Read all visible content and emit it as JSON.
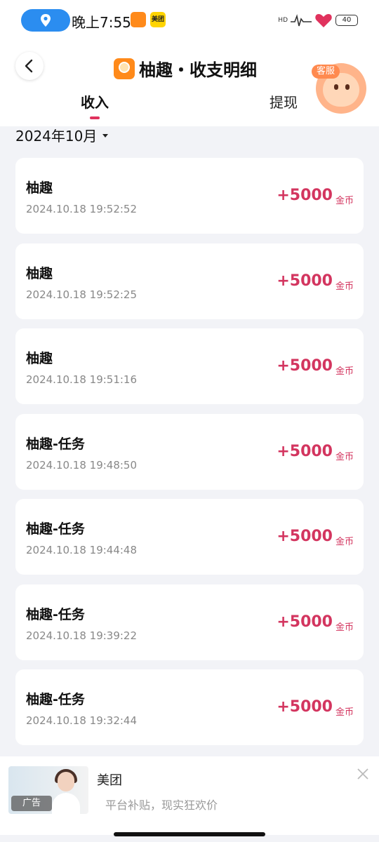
{
  "status_bar": {
    "time": "晚上7:55",
    "meituan_mini": "美团",
    "signal": "HD",
    "battery": "40"
  },
  "header": {
    "title": "柚趣・收支明细",
    "customer_service": "客服"
  },
  "tabs": [
    {
      "label": "收入",
      "active": true
    },
    {
      "label": "提现",
      "active": false
    }
  ],
  "month_filter": "2024年10月",
  "records": [
    {
      "title": "柚趣",
      "time": "2024.10.18 19:52:52",
      "amount": "+5000",
      "unit": "金币"
    },
    {
      "title": "柚趣",
      "time": "2024.10.18 19:52:25",
      "amount": "+5000",
      "unit": "金币"
    },
    {
      "title": "柚趣",
      "time": "2024.10.18 19:51:16",
      "amount": "+5000",
      "unit": "金币"
    },
    {
      "title": "柚趣-任务",
      "time": "2024.10.18 19:48:50",
      "amount": "+5000",
      "unit": "金币"
    },
    {
      "title": "柚趣-任务",
      "time": "2024.10.18 19:44:48",
      "amount": "+5000",
      "unit": "金币"
    },
    {
      "title": "柚趣-任务",
      "time": "2024.10.18 19:39:22",
      "amount": "+5000",
      "unit": "金币"
    },
    {
      "title": "柚趣-任务",
      "time": "2024.10.18 19:32:44",
      "amount": "+5000",
      "unit": "金币"
    }
  ],
  "ad": {
    "tag": "广告",
    "brand": "美团",
    "subtitle": "平台补贴，现实狂欢价"
  },
  "colors": {
    "accent": "#d3355f",
    "location_pill": "#2b8df0",
    "app_orange": "#ff8a1a"
  }
}
